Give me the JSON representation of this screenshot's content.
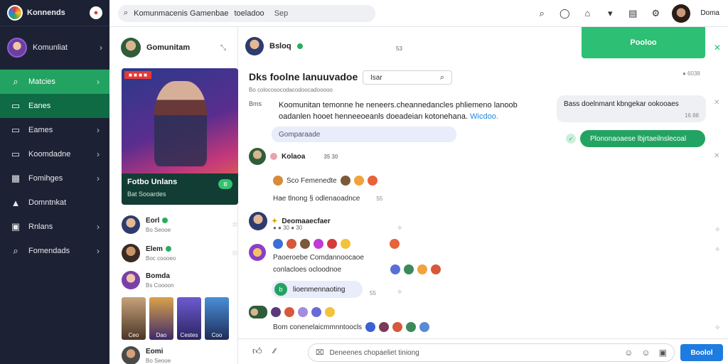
{
  "sidebar": {
    "brand": "Konnends",
    "badge": "●",
    "profile_name": "Komunliat",
    "items": [
      {
        "label": "Matcies",
        "icon": "search-icon"
      },
      {
        "label": "Eanes",
        "icon": "chat-icon"
      },
      {
        "label": "Eames",
        "icon": "folder-icon"
      },
      {
        "label": "Koomdadne",
        "icon": "folder-icon"
      },
      {
        "label": "Fomihges",
        "icon": "grid-icon"
      },
      {
        "label": "Domntnkat",
        "icon": "user-icon"
      },
      {
        "label": "Rnlans",
        "icon": "bag-icon"
      },
      {
        "label": "Fomendads",
        "icon": "search-icon"
      }
    ]
  },
  "topbar": {
    "search_text": "Komunmacenis Gamenbae",
    "search_tag": "toeladoo",
    "search_sep": "Sep",
    "user_name": "Doma"
  },
  "midcol": {
    "header_name": "Gomunitam",
    "featured": {
      "tag": "■ ■ ■ ■",
      "title": "Fotbo Unlans",
      "subtitle": "Bat Sooardes",
      "badge": "lll"
    },
    "friends": [
      {
        "name": "Eorl",
        "status": "Bo Seooe",
        "online": true
      },
      {
        "name": "Elem",
        "status": "Boc coooeo",
        "online": true
      },
      {
        "name": "Bomda",
        "status": "Bs Coooon",
        "online": false
      }
    ],
    "cards": [
      "Ceo",
      "Dao",
      "Cestes",
      "Coo"
    ],
    "bottom_friend": {
      "name": "Eomi",
      "status": "Bo Seooe"
    }
  },
  "chat": {
    "header_name": "Bsloq",
    "header_time": "53",
    "cta_label": "Pooloo",
    "topic_title": "Dks foolne lanuuvadoe",
    "topic_input": "Isar",
    "topic_meta": "Bo colocosocodacodoocadooooo",
    "date_tag": "● 6038",
    "sys_label": "Bms",
    "intro_text": "Koomunitan temonne he neneers.cheannedancles phliemeno lanoob oadanlen hooet henneeoeanls doeadeian kotonehana.",
    "intro_link": "Wicdoo.",
    "pill_tag": "Gomparaade",
    "incoming_text": "Bass doelnmant kbngekar ookooaes",
    "incoming_time": "16 88",
    "outgoing_text": "Plononaoaese lbjrtaeilnslecoal",
    "messages": [
      {
        "name": "Kolaoa",
        "time": "35 30",
        "line": "Sco Femenedte",
        "sub": "Hae tlnong § odlenaoadnce",
        "sub_time": "55"
      },
      {
        "name": "Deomaaecfaer",
        "time": "● ● 30 ● 30",
        "line": "Paoeroebe Comdannoocaoe",
        "sub": "conlacloes ocloodnoe",
        "sub_time": "55"
      },
      {
        "name": "",
        "time": "",
        "line": "Bom conenelaicmmnntoocls",
        "sub": "",
        "sub_time": ""
      }
    ],
    "pill_green_text": "lioenmennaoting",
    "pill_green_time": "55",
    "composer_placeholder": "Deneenes chopaeliet tiniong",
    "send_label": "Boolol"
  }
}
